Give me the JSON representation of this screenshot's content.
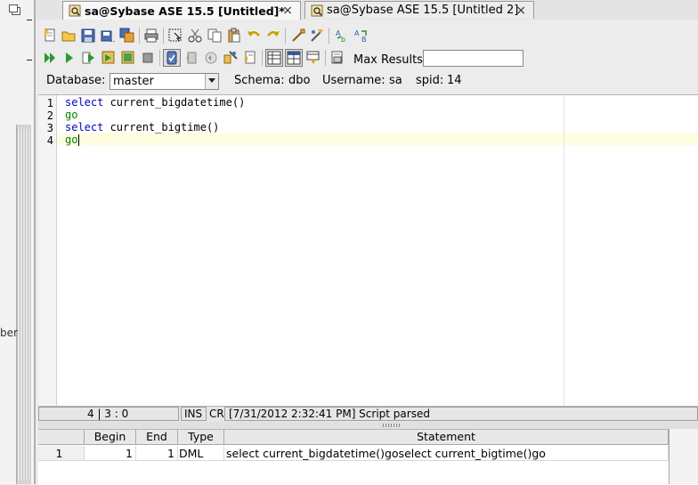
{
  "tabs": [
    {
      "label": "sa@Sybase ASE 15.5 [Untitled]*",
      "active": true,
      "close": "×"
    },
    {
      "label": "sa@Sybase ASE 15.5 [Untitled 2]",
      "active": false,
      "close": "×"
    }
  ],
  "left_panel": {
    "cut_text": "ber"
  },
  "toolbar": {
    "max_results_label": "Max Results:",
    "max_results_value": ""
  },
  "connection": {
    "database_label": "Database:",
    "database_value": "master",
    "schema_label": "Schema:",
    "schema_value": "dbo",
    "username_label": "Username:",
    "username_value": "sa",
    "spid_label": "spid:",
    "spid_value": "14"
  },
  "editor": {
    "lines": [
      {
        "num": "1",
        "kw": "select",
        "rest": " current_bigdatetime()",
        "kw_class": "kw"
      },
      {
        "num": "2",
        "kw": "go",
        "rest": "",
        "kw_class": "kw2"
      },
      {
        "num": "3",
        "kw": "select",
        "rest": " current_bigtime()",
        "kw_class": "kw"
      },
      {
        "num": "4",
        "kw": "go",
        "rest": "",
        "kw_class": "kw2"
      }
    ]
  },
  "status": {
    "position": "4 | 3 : 0",
    "mode": "INS",
    "line_ending": "CR",
    "message": "[7/31/2012 2:32:41 PM] Script parsed"
  },
  "results": {
    "columns": [
      "",
      "Begin",
      "End",
      "Type",
      "Statement"
    ],
    "rows": [
      [
        "1",
        "1",
        "1",
        "DML",
        "select current_bigdatetime()goselect current_bigtime()go"
      ]
    ]
  },
  "colors": {
    "keyword": "#0000c8",
    "go_keyword": "#008000",
    "current_line": "#fffde0"
  }
}
